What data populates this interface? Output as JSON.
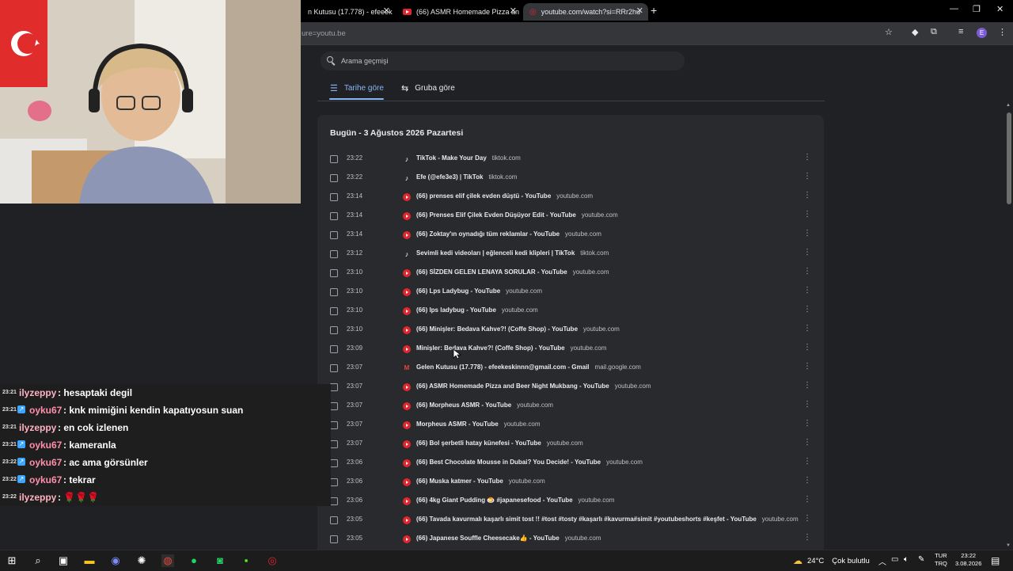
{
  "browser": {
    "tabs": [
      {
        "label": "n Kutusu (17.778) - efeeek",
        "icon": "gmail-icon",
        "active": false
      },
      {
        "label": "(66) ASMR Homemade Pizza an",
        "icon": "youtube-icon",
        "active": false
      },
      {
        "label": "youtube.com/watch?si=RRr2hu",
        "icon": "opera-icon",
        "active": true
      }
    ],
    "url": "ure=youtu.be"
  },
  "history": {
    "search_placeholder": "Arama geçmişi",
    "tabs": [
      {
        "label": "Tarihe göre",
        "icon": "list-icon",
        "active": true
      },
      {
        "label": "Gruba göre",
        "icon": "group-icon",
        "active": false
      }
    ],
    "date_header": "Bugün - 3 Ağustos 2026 Pazartesi",
    "entries": [
      {
        "time": "23:22",
        "title": "TikTok - Make Your Day",
        "domain": "tiktok.com",
        "icon": "tiktok"
      },
      {
        "time": "23:22",
        "title": "Efe (@efe3e3) | TikTok",
        "domain": "tiktok.com",
        "icon": "tiktok"
      },
      {
        "time": "23:14",
        "title": "(66) prenses elif çilek evden düştü - YouTube",
        "domain": "youtube.com",
        "icon": "youtube"
      },
      {
        "time": "23:14",
        "title": "(66) Prenses Elif Çilek Evden Düşüyor Edit - YouTube",
        "domain": "youtube.com",
        "icon": "youtube"
      },
      {
        "time": "23:14",
        "title": "(66) Zoktay'ın oynadığı tüm reklamlar - YouTube",
        "domain": "youtube.com",
        "icon": "youtube"
      },
      {
        "time": "23:12",
        "title": "Sevimli kedi videoları | eğlenceli kedi klipleri | TikTok",
        "domain": "tiktok.com",
        "icon": "tiktok"
      },
      {
        "time": "23:10",
        "title": "(66) SİZDEN GELEN LENAYA SORULAR - YouTube",
        "domain": "youtube.com",
        "icon": "youtube"
      },
      {
        "time": "23:10",
        "title": "(66) Lps Ladybug - YouTube",
        "domain": "youtube.com",
        "icon": "youtube"
      },
      {
        "time": "23:10",
        "title": "(66) lps ladybug - YouTube",
        "domain": "youtube.com",
        "icon": "youtube"
      },
      {
        "time": "23:10",
        "title": "(66) Minişler: Bedava Kahve?! (Coffe Shop) - YouTube",
        "domain": "youtube.com",
        "icon": "youtube"
      },
      {
        "time": "23:09",
        "title": "Minişler: Bedava Kahve?! (Coffe Shop) - YouTube",
        "domain": "youtube.com",
        "icon": "youtube"
      },
      {
        "time": "23:07",
        "title": "Gelen Kutusu (17.778) - efeekeskinnn@gmail.com - Gmail",
        "domain": "mail.google.com",
        "icon": "gmail"
      },
      {
        "time": "23:07",
        "title": "(66) ASMR Homemade Pizza and Beer Night Mukbang - YouTube",
        "domain": "youtube.com",
        "icon": "youtube"
      },
      {
        "time": "23:07",
        "title": "(66) Morpheus ASMR - YouTube",
        "domain": "youtube.com",
        "icon": "youtube"
      },
      {
        "time": "23:07",
        "title": "Morpheus ASMR - YouTube",
        "domain": "youtube.com",
        "icon": "youtube"
      },
      {
        "time": "23:07",
        "title": "(66) Bol şerbetli hatay künefesi - YouTube",
        "domain": "youtube.com",
        "icon": "youtube"
      },
      {
        "time": "23:06",
        "title": "(66) Best Chocolate Mousse in Dubai? You Decide! - YouTube",
        "domain": "youtube.com",
        "icon": "youtube"
      },
      {
        "time": "23:06",
        "title": "(66) Muska katmer - YouTube",
        "domain": "youtube.com",
        "icon": "youtube"
      },
      {
        "time": "23:06",
        "title": "(66) 4kg Giant Pudding 🍮 #japanesefood - YouTube",
        "domain": "youtube.com",
        "icon": "youtube"
      },
      {
        "time": "23:05",
        "title": "(66) Tavada kavurmalı kaşarlı simit tost !! #tost #tosty #kaşarlı #kavurma#simit #youtubeshorts #keşfet - YouTube",
        "domain": "youtube.com",
        "icon": "youtube"
      },
      {
        "time": "23:05",
        "title": "(66) Japanese Souffle Cheesecake👍 - YouTube",
        "domain": "youtube.com",
        "icon": "youtube"
      }
    ]
  },
  "chat": {
    "messages": [
      {
        "time": "23:21",
        "user": "ilyzeppy",
        "badge": false,
        "color": "#ffb3c1",
        "message": ": hesaptaki degil"
      },
      {
        "time": "23:21",
        "user": "oyku67",
        "badge": true,
        "color": "#ff8fab",
        "message": ": knk mimiğini kendin kapatıyosun suan"
      },
      {
        "time": "23:21",
        "user": "ilyzeppy",
        "badge": false,
        "color": "#ffb3c1",
        "message": ": en cok izlenen"
      },
      {
        "time": "23:21",
        "user": "oyku67",
        "badge": true,
        "color": "#ff8fab",
        "message": ": kameranla"
      },
      {
        "time": "23:22",
        "user": "oyku67",
        "badge": true,
        "color": "#ff8fab",
        "message": ": ac ama görsünler"
      },
      {
        "time": "23:22",
        "user": "oyku67",
        "badge": true,
        "color": "#ff8fab",
        "message": ": tekrar"
      },
      {
        "time": "23:22",
        "user": "ilyzeppy",
        "badge": false,
        "color": "#ffb3c1",
        "message": ": 🌹🌹🌹"
      }
    ]
  },
  "taskbar": {
    "weather_temp": "24°C",
    "weather_text": "Çok bulutlu",
    "lang_line1": "TUR",
    "lang_line2": "TRQ",
    "clock_time": "23:22",
    "clock_date": "3.08.2026"
  }
}
